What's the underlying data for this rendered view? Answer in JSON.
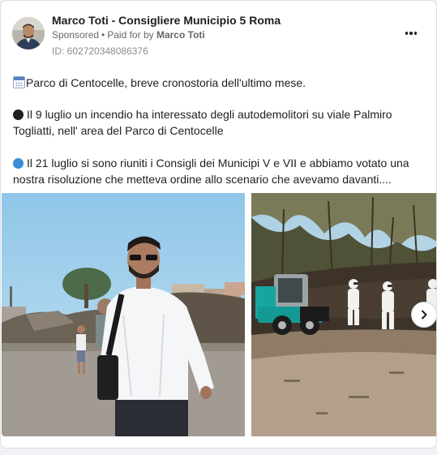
{
  "post": {
    "author": "Marco Toti - Consigliere Municipio 5 Roma",
    "sponsored_label": "Sponsored",
    "paid_by_prefix": "Paid for by",
    "paid_by_name": "Marco Toti",
    "ad_id": "ID: 602720348086376",
    "paragraphs": {
      "p1": "Parco di Centocelle, breve cronostoria dell'ultimo mese.",
      "p2": "Il 9 luglio un incendio ha interessato degli autodemolitori su viale Palmiro Togliatti, nell' area del Parco di Centocelle",
      "p3": "Il 21 luglio si sono riuniti i Consigli dei Municipi V e VII e abbiamo votato una nostra risoluzione che metteva ordine allo scenario che avevamo davanti...."
    },
    "icons": {
      "p1": "calendar-emoji-icon",
      "p2": "black-circle-emoji-icon",
      "p3": "blue-circle-emoji-icon"
    }
  },
  "carousel": {
    "slides": [
      {
        "name": "photo-man-in-white-shirt"
      },
      {
        "name": "photo-burned-park-cleanup"
      }
    ],
    "next_icon": "chevron-right-icon"
  },
  "colors": {
    "text_primary": "#1c1e21",
    "text_secondary": "#65676b",
    "card_border": "#dddfe2"
  }
}
